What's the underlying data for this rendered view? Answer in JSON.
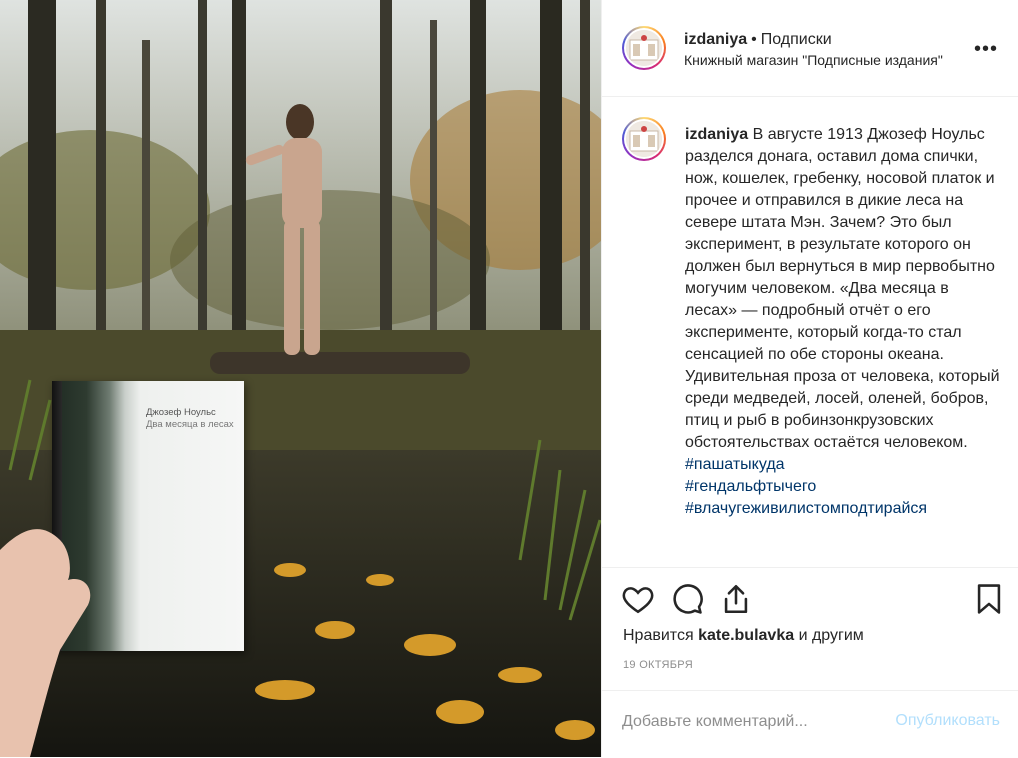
{
  "post": {
    "username": "izdaniya",
    "dot": "•",
    "follow_label": "Подписки",
    "location": "Книжный магазин \"Подписные издания\"",
    "more_label": "•••"
  },
  "photo": {
    "book_author": "Джозеф Ноульс",
    "book_title": "Два месяца в лесах"
  },
  "caption": {
    "username": "izdaniya",
    "text": " В августе 1913 Джозеф Ноульс разделся донага, оставил дома спички, нож, кошелек, гребенку, носовой платок и прочее и отправился в дикие леса на севере штата Мэн. Зачем? Это был эксперимент, в результате которого он должен был вернуться в мир первобытно могучим человеком. «Два месяца в лесах» — подробный отчёт о его эксперименте, который когда-то стал сенсацией по обе стороны океана. Удивительная проза от человека, который среди медведей, лосей, оленей, бобров, птиц и рыб в робинзонкрузовских обстоятельствах остаётся человеком. ",
    "hashtags": [
      "#пашатыкуда",
      "#гендальфтычего",
      "#влачугеживилистомподтирайся"
    ]
  },
  "actions": {
    "likes_prefix": "Нравится",
    "likes_user": "kate.bulavka",
    "likes_suffix": "и другим",
    "date": "19 октября"
  },
  "comment": {
    "placeholder": "Добавьте комментарий...",
    "post_label": "Опубликовать"
  },
  "colors": {
    "link": "#003569",
    "post_button_disabled": "#b2dffc",
    "muted": "#8e8e8e"
  }
}
